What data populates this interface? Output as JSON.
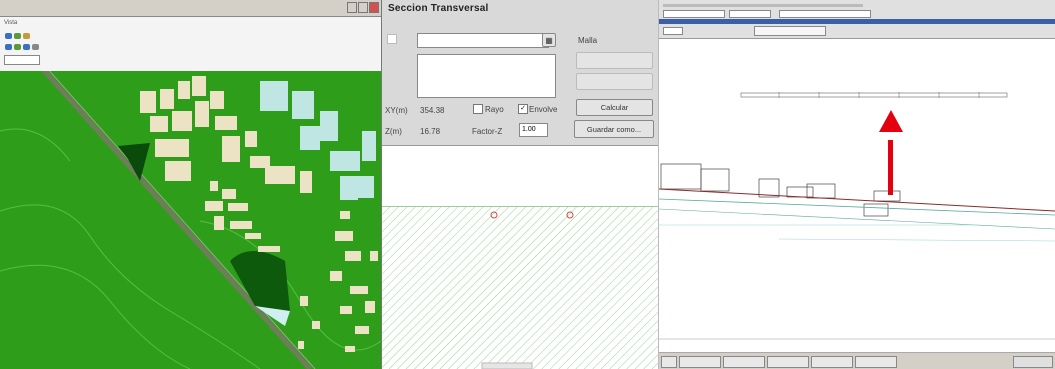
{
  "left_window": {
    "menu": "Vista"
  },
  "dialog": {
    "title": "Seccion Transversal",
    "malla_label": "Malla",
    "xy_label": "XY(m)",
    "xy_value": "354.38",
    "z_label": "Z(m)",
    "z_value": "16.78",
    "rayo_label": "Rayo",
    "rayo_checked": false,
    "envolvente_label": "Envolve",
    "envolvente_checked": true,
    "factor_z_label": "Factor-Z",
    "factor_z_value": "1.00",
    "calcular_label": "Calcular",
    "guardar_label": "Guardar como...",
    "checkmark": "✓"
  },
  "colors": {
    "terrain_green": "#2e9e1a",
    "building": "#ece3c4",
    "building_cyan": "#bfe6e2",
    "dialog_bg": "#d9d9d9",
    "hatch": "#7dc77a",
    "arrow": "#e5000f"
  },
  "icons": {
    "close": "close-icon",
    "browse": "folder-icon",
    "arrow": "arrow-up-icon"
  }
}
